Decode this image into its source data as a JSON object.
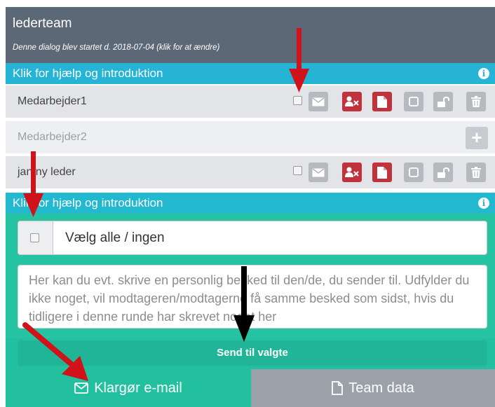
{
  "header": {
    "title": "lederteam",
    "subtitle": "Denne dialog blev startet d. 2018-07-04 (klik for at ændre)"
  },
  "help_bars": [
    {
      "label": "Klik for hjælp og introduktion",
      "icon": "info-icon"
    },
    {
      "label": "Klik for hjælp og introduktion",
      "icon": "info-icon"
    }
  ],
  "rows": [
    {
      "name": "Medarbejder1",
      "actions": [
        "email-icon",
        "remove-user-icon",
        "document-icon",
        "checkbox-square-icon",
        "unlock-icon",
        "trash-icon"
      ]
    },
    {
      "name": "Medarbejder2",
      "actions": [
        "plus-icon"
      ]
    },
    {
      "name": "jan ny leder",
      "actions": [
        "email-icon",
        "remove-user-icon",
        "document-icon",
        "checkbox-square-icon",
        "unlock-icon",
        "trash-icon"
      ]
    }
  ],
  "select_all": {
    "label": "Vælg alle / ingen"
  },
  "message": {
    "placeholder": "Her kan du evt. skrive en personlig besked til den/de, du sender til. Udfylder du ikke noget, vil modtageren/modtagerne få samme besked som sidst, hvis du tidligere i denne runde har skrevet noget her"
  },
  "send_button": {
    "label": "Send til valgte"
  },
  "tabs": [
    {
      "label": "Klargør e-mail",
      "icon": "envelope-icon"
    },
    {
      "label": "Team data",
      "icon": "file-icon"
    }
  ],
  "colors": {
    "header": "#5d6877",
    "help_bar": "#25b3d6",
    "teal": "#27c4a4",
    "danger": "#c0333c",
    "annotation_red": "#d0121b"
  }
}
